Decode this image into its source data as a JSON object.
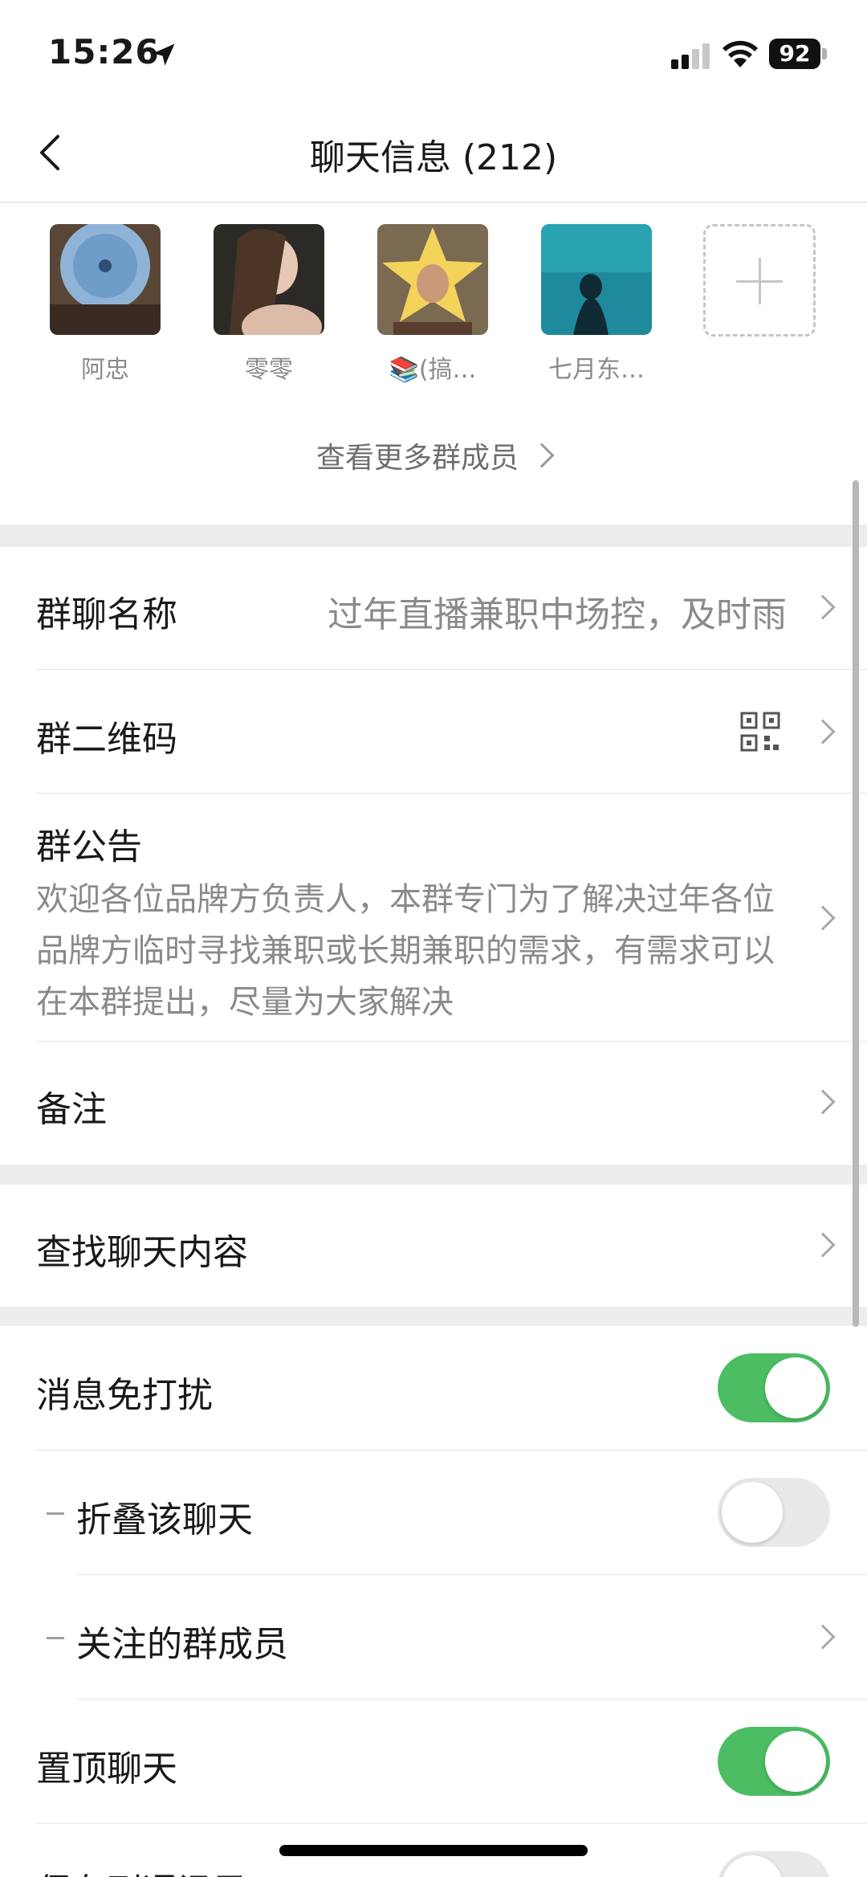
{
  "status_bar": {
    "time": "15:26",
    "battery": "92"
  },
  "nav": {
    "title": "聊天信息 (212)"
  },
  "members": {
    "items": [
      {
        "name": "阿忠"
      },
      {
        "name": "零零"
      },
      {
        "name": "📚(搞…"
      },
      {
        "name": "七月东…"
      }
    ],
    "more_label": "查看更多群成员"
  },
  "settings": {
    "group_name_label": "群聊名称",
    "group_name_value": "过年直播兼职中场控，及时雨",
    "qr_label": "群二维码",
    "announcement_label": "群公告",
    "announcement_text": "欢迎各位品牌方负责人，本群专门为了解决过年各位品牌方临时寻找兼职或长期兼职的需求，有需求可以在本群提出，尽量为大家解决",
    "remark_label": "备注",
    "search_label": "查找聊天内容",
    "mute_label": "消息免打扰",
    "mute_on": true,
    "fold_label": "折叠该聊天",
    "fold_on": false,
    "follow_label": "关注的群成员",
    "pin_label": "置顶聊天",
    "pin_on": true,
    "save_label": "保存到通讯录"
  }
}
